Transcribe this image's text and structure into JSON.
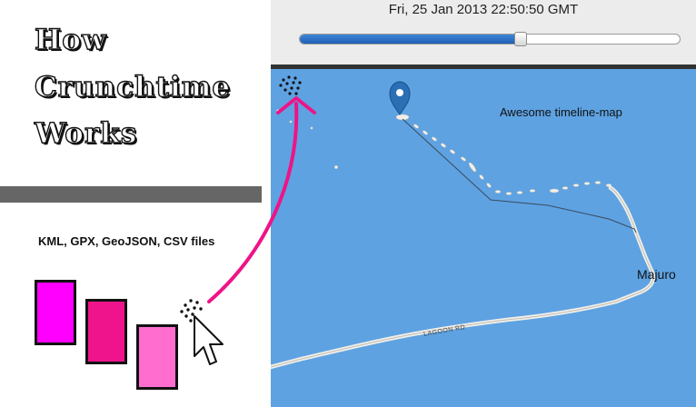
{
  "explainer": {
    "title_lines": [
      "How",
      "Crunchtime",
      "Works"
    ],
    "formats_text": "KML, GPX, GeoJSON, CSV files",
    "file_colors": [
      "#ff00ff",
      "#f0148c",
      "#ff6ecf"
    ],
    "arrow_color": "#ee1487"
  },
  "timeline": {
    "timestamp": "Fri, 25 Jan 2013 22:50:50 GMT",
    "progress": 0.58
  },
  "map": {
    "title": "Awesome timeline-map",
    "city_label": "Majuro",
    "road_label": "LAGOON RD",
    "water_color": "#5ea2e2",
    "marker_color": "#2b6fb5"
  }
}
